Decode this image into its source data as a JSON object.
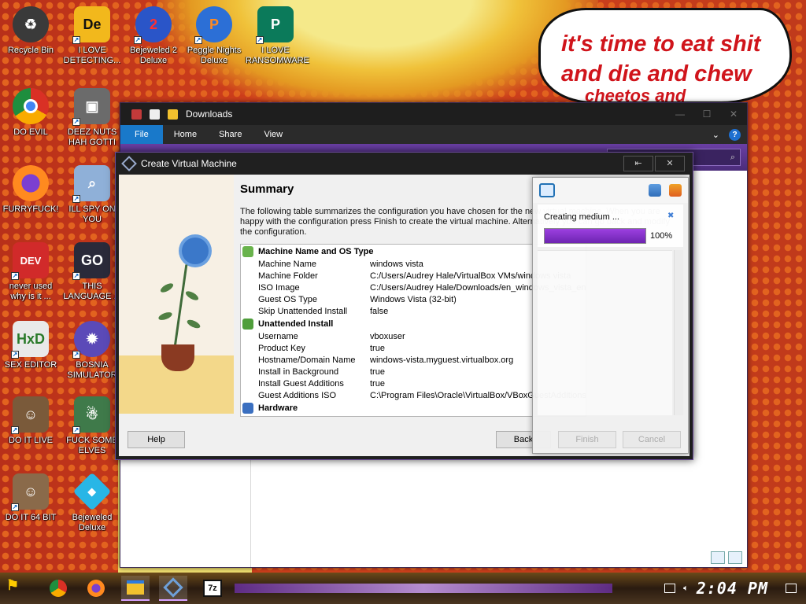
{
  "wallpaper": {
    "bubble_lines": [
      "it's time to eat shit",
      "and die and chew",
      "cheetos and"
    ]
  },
  "desktop_icons": [
    {
      "label": "Recycle Bin",
      "icon": "recycle-bin-icon",
      "color": "#3a3a3a"
    },
    {
      "label": "I LOVE DETECTING...",
      "icon": "de-icon",
      "color": "#f2b81c"
    },
    {
      "label": "Bejeweled 2 Deluxe",
      "icon": "bejeweled2-icon",
      "color": "#2a55c8"
    },
    {
      "label": "Peggle Nights Deluxe",
      "icon": "peggle-icon",
      "color": "#2c6fd6"
    },
    {
      "label": "I LOVE RANSOMWARE",
      "icon": "publisher-icon",
      "color": "#0b7a5a"
    },
    {
      "label": "DO EVIL",
      "icon": "chrome-icon",
      "color": "#2c8f43"
    },
    {
      "label": "DEEZ NUTS HAH GOTTI",
      "icon": "windows-icon",
      "color": "#6b6b6b"
    },
    {
      "label": "FURRYFUCK!",
      "icon": "firefox-icon",
      "color": "#e8612c"
    },
    {
      "label": "ILL SPY ON YOU",
      "icon": "spy-icon",
      "color": "#8fb0d8"
    },
    {
      "label": "never used why is it ...",
      "icon": "devcpp-icon",
      "color": "#d12a2a"
    },
    {
      "label": "THIS LANGUAGE ...",
      "icon": "go-icon",
      "color": "#2a2a3a"
    },
    {
      "label": "SEX EDITOR",
      "icon": "hxd-icon",
      "color": "#e9e9e9"
    },
    {
      "label": "BOSNIA SIMULATOR",
      "icon": "mine-icon",
      "color": "#5b4ab8"
    },
    {
      "label": "DO IT LIVE",
      "icon": "portrait-icon",
      "color": "#7a5a3a"
    },
    {
      "label": "FUCK SOME ELVES",
      "icon": "santa-icon",
      "color": "#3f7a4a"
    },
    {
      "label": "DO IT 64 BIT",
      "icon": "portrait64-icon",
      "color": "#8a6a4a"
    },
    {
      "label": "Bejeweled Deluxe",
      "icon": "gem-icon",
      "color": "#28b6e6"
    }
  ],
  "explorer": {
    "title": "Downloads",
    "tabs": [
      "File",
      "Home",
      "Share",
      "View"
    ],
    "help": "?"
  },
  "wizard": {
    "title": "Create Virtual Machine",
    "title_buttons": [
      "⇤",
      "✕"
    ],
    "heading": "Summary",
    "description": "The following table summarizes the configuration you have chosen for the new virtual machine. When you are happy with the configuration press Finish to create the virtual machine. Alternatively you can go back and modify the configuration.",
    "groups": [
      {
        "name": "Machine Name and OS Type",
        "color": "#69b34c",
        "rows": [
          {
            "key": "Machine Name",
            "value": "windows vista"
          },
          {
            "key": "Machine Folder",
            "value": "C:/Users/Audrey Hale/VirtualBox VMs/windows vista"
          },
          {
            "key": "ISO Image",
            "value": "C:/Users/Audrey Hale/Downloads/en_windows_vista_enterprise_sp2_x"
          },
          {
            "key": "Guest OS Type",
            "value": "Windows Vista (32-bit)"
          },
          {
            "key": "Skip Unattended Install",
            "value": "false"
          }
        ]
      },
      {
        "name": "Unattended Install",
        "color": "#4f9e3b",
        "rows": [
          {
            "key": "Username",
            "value": "vboxuser"
          },
          {
            "key": "Product Key",
            "value": "true"
          },
          {
            "key": "Hostname/Domain Name",
            "value": "windows-vista.myguest.virtualbox.org"
          },
          {
            "key": "Install in Background",
            "value": "true"
          },
          {
            "key": "Install Guest Additions",
            "value": "true"
          },
          {
            "key": "Guest Additions ISO",
            "value": "C:\\Program Files\\Oracle\\VirtualBox/VBoxGuestAdditions.iso"
          }
        ]
      },
      {
        "name": "Hardware",
        "color": "#3a6fc0",
        "rows": []
      }
    ],
    "buttons": {
      "help": "Help",
      "back": "Back"
    }
  },
  "progress": {
    "item_label": "Creating medium ...",
    "percent_text": "100%",
    "percent": 100,
    "buttons": {
      "finish": "Finish",
      "cancel": "Cancel"
    }
  },
  "taskbar": {
    "clock": "2:04 PM",
    "items": [
      {
        "icon": "chrome-icon",
        "color": "#2c8f43"
      },
      {
        "icon": "firefox-icon",
        "color": "#e8612c"
      },
      {
        "icon": "file-explorer-icon",
        "color": "#f2c12e"
      },
      {
        "icon": "virtualbox-icon",
        "color": "#6ea0d8"
      },
      {
        "icon": "7zip-icon",
        "color": "#e6e6e6"
      }
    ]
  }
}
